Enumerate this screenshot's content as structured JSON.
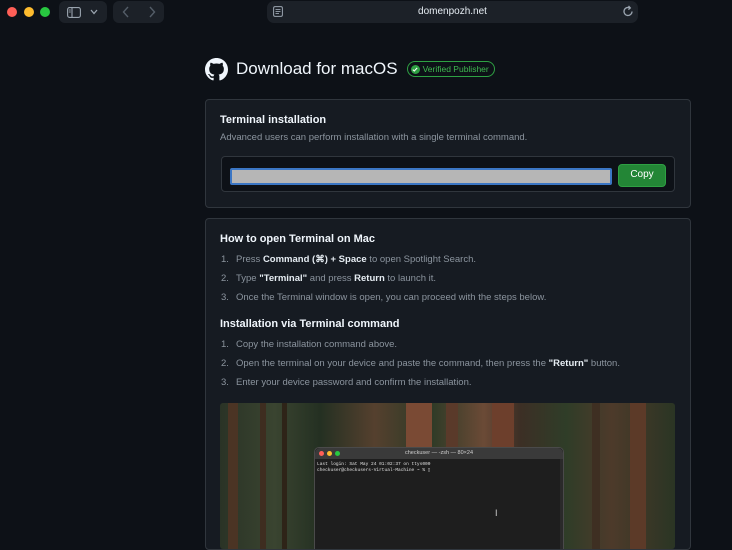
{
  "browser": {
    "url": "domenpozh.net"
  },
  "header": {
    "title": "Download for macOS",
    "badge": "Verified Publisher"
  },
  "terminal_card": {
    "title": "Terminal installation",
    "subtitle": "Advanced users can perform installation with a single terminal command.",
    "command_value": "",
    "copy_label": "Copy"
  },
  "open_terminal": {
    "title": "How to open Terminal on Mac",
    "steps": [
      {
        "num": "1.",
        "pre": "Press ",
        "bold": "Command (⌘) + Space",
        "post": " to open Spotlight Search."
      },
      {
        "num": "2.",
        "pre": "Type ",
        "bold": "\"Terminal\"",
        "mid": " and press ",
        "bold2": "Return",
        "post": " to launch it."
      },
      {
        "num": "3.",
        "text": "Once the Terminal window is open, you can proceed with the steps below."
      }
    ]
  },
  "install_via": {
    "title": "Installation via Terminal command",
    "steps": [
      {
        "num": "1.",
        "text": "Copy the installation command above."
      },
      {
        "num": "2.",
        "pre": "Open the terminal on your device and paste the command, then press the ",
        "bold": "\"Return\"",
        "post": " button."
      },
      {
        "num": "3.",
        "text": "Enter your device password and confirm the installation."
      }
    ]
  },
  "terminal_window": {
    "title": "checkuser — -zsh — 80×24",
    "lines": [
      "Last login: Sat May 24 01:02:37 on ttys000",
      "checkuser@checkusers-Virtual-Machine ~ % ▯"
    ]
  },
  "colors": {
    "background": "#0d1117",
    "card": "#161b22",
    "accent_green": "#238636",
    "verified_green": "#3fb950"
  }
}
